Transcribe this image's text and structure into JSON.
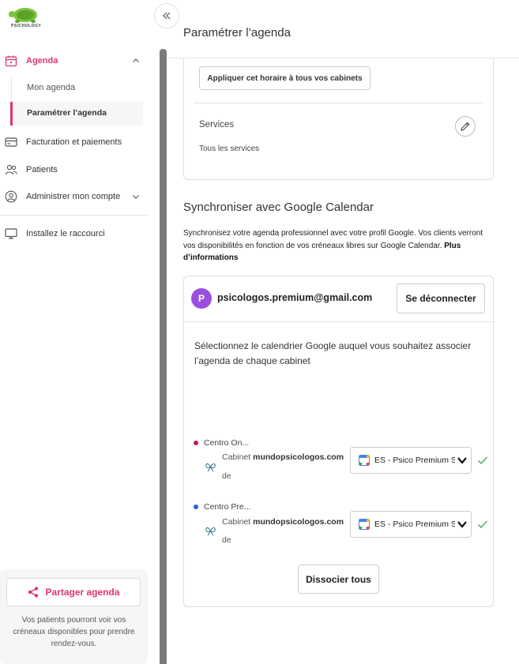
{
  "sidebar": {
    "logo_text": "PSICHOLOGY",
    "items": [
      {
        "label": "Agenda",
        "icon": "calendar-icon"
      },
      {
        "label": "Facturation et paiements",
        "icon": "credit-card-icon"
      },
      {
        "label": "Patients",
        "icon": "users-icon"
      },
      {
        "label": "Administrer mon compte",
        "icon": "user-circle-icon"
      },
      {
        "label": "Installez le raccourci",
        "icon": "monitor-icon"
      }
    ],
    "sub_items": [
      {
        "label": "Mon agenda"
      },
      {
        "label": "Paramétrer l’agenda"
      }
    ],
    "share": {
      "button_label": "Partager agenda",
      "icon": "share-icon",
      "description": "Vos patients pourront voir vos créneaux disponibles pour prendre rendez-vous."
    }
  },
  "header": {
    "title": "Paramétrer l’agenda"
  },
  "schedule_card": {
    "apply_label": "Appliquer cet horaire à tous vos cabinets",
    "services_label": "Services",
    "services_value": "Tous les services"
  },
  "sync": {
    "title": "Synchroniser avec Google Calendar",
    "description": "Synchronisez votre agenda professionnel avec votre profil Google. Vos clients verront vos disponibilités en fonction de vos créneaux libres sur Google Calendar.",
    "more_info": "Plus d’informations",
    "account": {
      "avatar_letter": "P",
      "email": "psicologos.premium@gmail.com",
      "disconnect_label": "Se déconnecter"
    },
    "select_prompt": "Sélectionnez le calendrier Google auquel vous souhaitez associer l’agenda de chaque cabinet",
    "centers": [
      {
        "name": "Centro On...",
        "dot_color": "#c2185b",
        "cabinet_prefix": "Cabinet ",
        "cabinet_domain": "mundopsicologos.com",
        "cabinet_suffix": "de",
        "calendar_value": "ES - Psico Premium Su"
      },
      {
        "name": "Centro Pre...",
        "dot_color": "#2962d9",
        "cabinet_prefix": "Cabinet ",
        "cabinet_domain": "mundopsicologos.com",
        "cabinet_suffix": "de",
        "calendar_value": "ES - Psico Premium Su"
      }
    ],
    "dissociate_label": "Dissocier tous"
  },
  "colors": {
    "accent": "#e0356f",
    "avatar": "#9b4fe0",
    "check": "#3aa757"
  }
}
